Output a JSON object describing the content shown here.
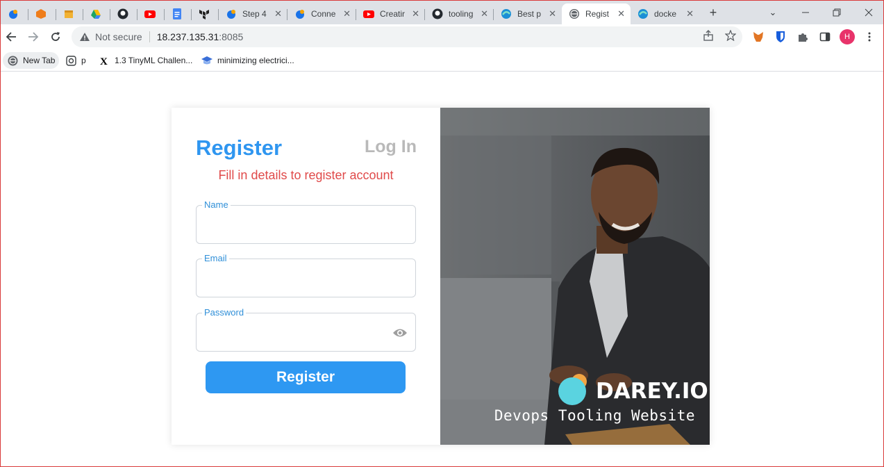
{
  "browser": {
    "tabs": [
      {
        "title": "",
        "icon": "blue-circle-icon"
      },
      {
        "title": "",
        "icon": "orange-cube-icon"
      },
      {
        "title": "",
        "icon": "yellow-box-icon"
      },
      {
        "title": "",
        "icon": "google-drive-icon"
      },
      {
        "title": "",
        "icon": "github-icon"
      },
      {
        "title": "",
        "icon": "youtube-icon"
      },
      {
        "title": "",
        "icon": "google-docs-icon"
      },
      {
        "title": "",
        "icon": "terraform-icon"
      },
      {
        "title": "Step 4",
        "icon": "blue-circle-icon"
      },
      {
        "title": "Conne",
        "icon": "blue-circle-icon"
      },
      {
        "title": "Creatir",
        "icon": "youtube-icon"
      },
      {
        "title": "tooling",
        "icon": "github-icon"
      },
      {
        "title": "Best p",
        "icon": "edge-icon"
      },
      {
        "title": "Regist",
        "icon": "globe-icon",
        "active": true
      },
      {
        "title": "docke",
        "icon": "edge-icon"
      }
    ],
    "address": {
      "security_label": "Not secure",
      "host": "18.237.135.31",
      "port": ":8085"
    },
    "profile_initial": "H",
    "bookmarks": [
      {
        "label": "New Tab",
        "icon": "globe-icon"
      },
      {
        "label": "p",
        "icon": "instagram-icon"
      },
      {
        "label": "1.3 TinyML Challen...",
        "icon": "edx-icon"
      },
      {
        "label": "minimizing electrici...",
        "icon": "graduation-cap-icon"
      }
    ]
  },
  "page": {
    "register_title": "Register",
    "login_link": "Log In",
    "subtitle": "Fill in details to register account",
    "fields": {
      "name_label": "Name",
      "name_value": "",
      "email_label": "Email",
      "email_value": "",
      "password_label": "Password",
      "password_value": ""
    },
    "submit_label": "Register",
    "brand": {
      "name": "DAREY.IO",
      "tagline": "Devops Tooling Website"
    }
  },
  "colors": {
    "accent": "#2e98f2",
    "subtitle": "#e04a4a",
    "inactive_tab": "#b9b9b9"
  }
}
